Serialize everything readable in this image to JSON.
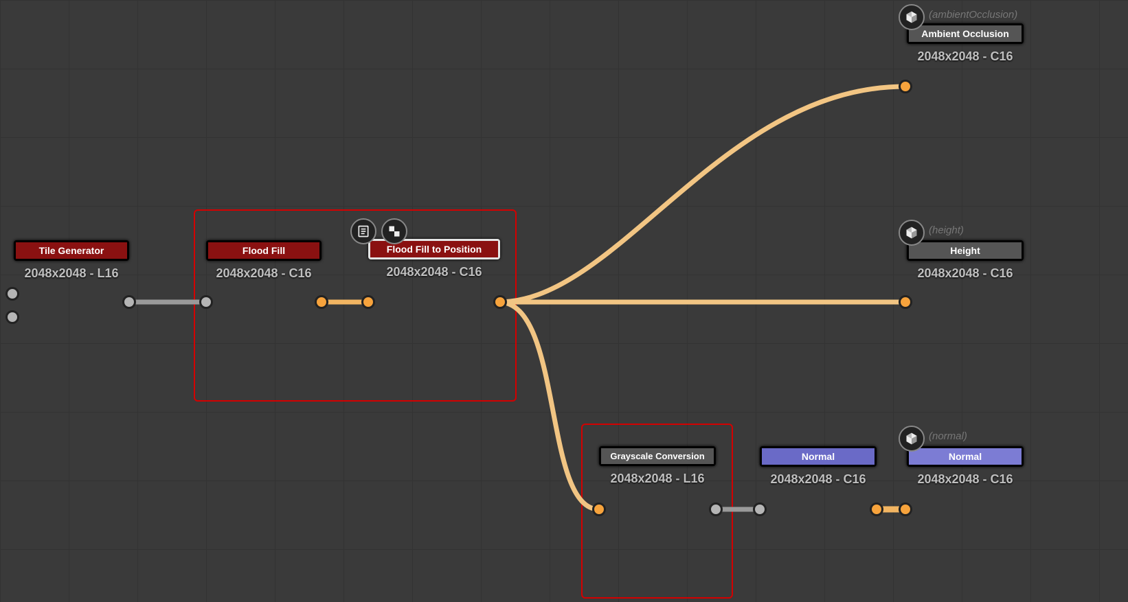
{
  "nodes": {
    "tile_gen": {
      "title": "Tile Generator",
      "caption": "2048x2048 - L16"
    },
    "flood_fill": {
      "title": "Flood Fill",
      "caption": "2048x2048 - C16"
    },
    "ff_to_pos": {
      "title": "Flood Fill to Position",
      "caption": "2048x2048 - C16"
    },
    "ao": {
      "title": "Ambient Occlusion",
      "caption": "2048x2048 - C16"
    },
    "height": {
      "title": "Height",
      "caption": "2048x2048 - C16"
    },
    "greyscale": {
      "title": "Grayscale Conversion",
      "caption": "2048x2048 - L16"
    },
    "normal_user": {
      "title": "Normal",
      "caption": "2048x2048 - C16"
    },
    "normal_out": {
      "title": "Normal",
      "caption": "2048x2048 - C16"
    }
  },
  "ghost_labels": {
    "ao": "(ambientOcclusion)",
    "height": "(height)",
    "normal": "(normal)"
  },
  "selection_groups": [
    "flood-fill-group",
    "grayscale-group"
  ],
  "canvas": {
    "grid_spacing": 100,
    "bg_color": "#3a3a3a"
  }
}
